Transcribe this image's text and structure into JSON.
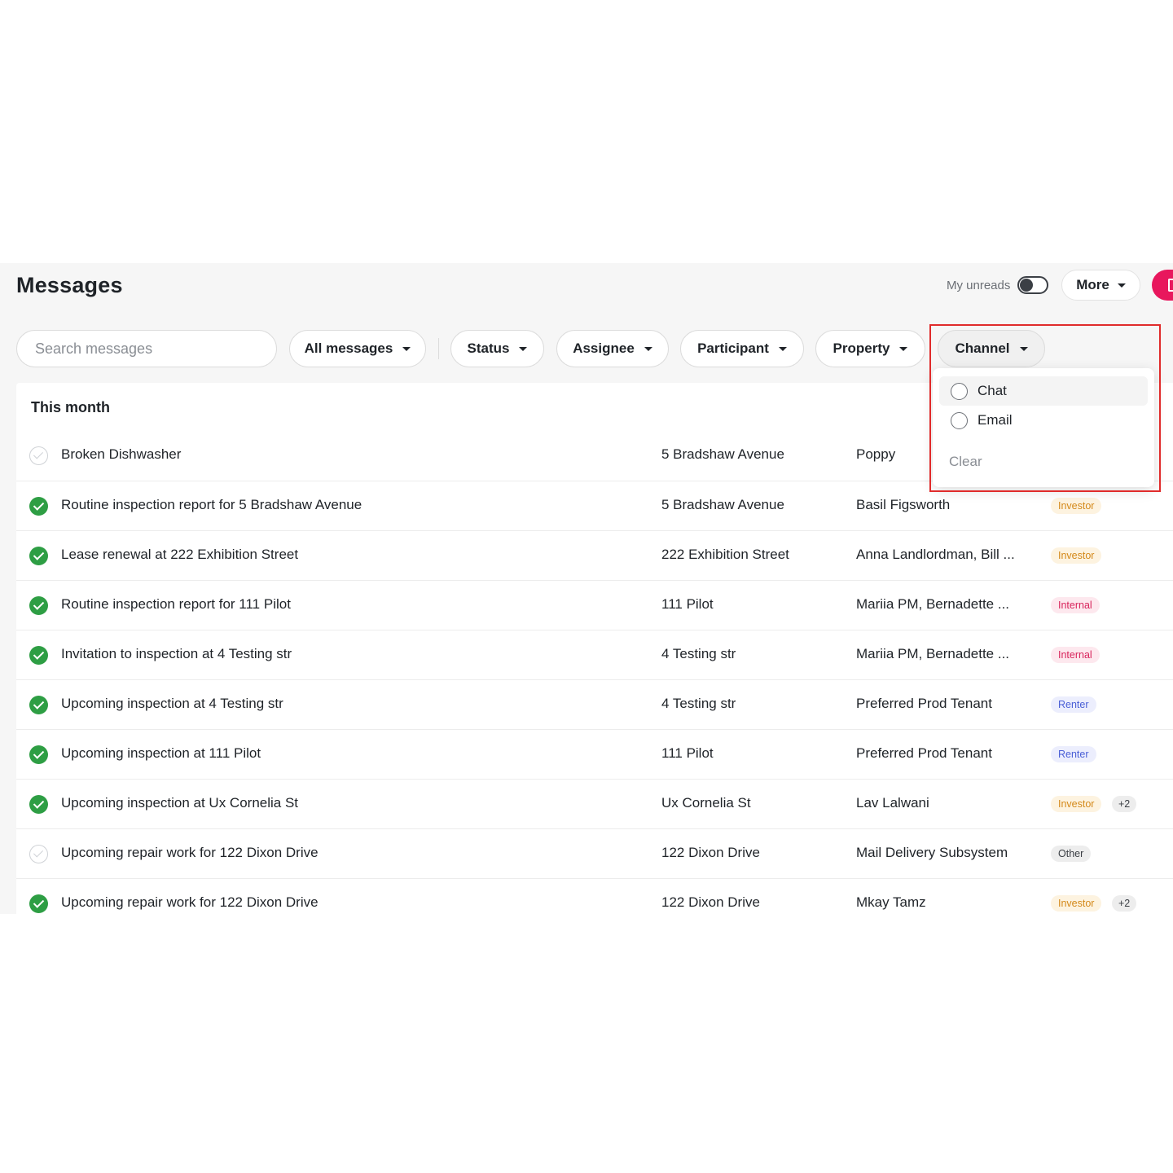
{
  "header": {
    "title": "Messages",
    "unreads_label": "My unreads",
    "more_label": "More"
  },
  "filters": {
    "search_placeholder": "Search messages",
    "all_messages": "All messages",
    "status": "Status",
    "assignee": "Assignee",
    "participant": "Participant",
    "property": "Property",
    "channel": "Channel"
  },
  "section": {
    "title": "This month"
  },
  "rows": [
    {
      "status": "open",
      "subject": "Broken Dishwasher",
      "property": "5 Bradshaw Avenue",
      "people": "Poppy",
      "tag": "",
      "tag_type": "",
      "extra": ""
    },
    {
      "status": "done",
      "subject": "Routine inspection report for 5 Bradshaw Avenue",
      "property": "5 Bradshaw Avenue",
      "people": "Basil Figsworth",
      "tag": "Investor",
      "tag_type": "investor",
      "extra": ""
    },
    {
      "status": "done",
      "subject": "Lease renewal at 222 Exhibition Street",
      "property": "222 Exhibition Street",
      "people": "Anna Landlordman, Bill ...",
      "tag": "Investor",
      "tag_type": "investor",
      "extra": ""
    },
    {
      "status": "done",
      "subject": "Routine inspection report for 111 Pilot",
      "property": "111 Pilot",
      "people": "Mariia PM, Bernadette ...",
      "tag": "Internal",
      "tag_type": "internal",
      "extra": ""
    },
    {
      "status": "done",
      "subject": "Invitation to inspection at 4 Testing str",
      "property": "4 Testing str",
      "people": "Mariia PM, Bernadette ...",
      "tag": "Internal",
      "tag_type": "internal",
      "extra": ""
    },
    {
      "status": "done",
      "subject": "Upcoming inspection at 4 Testing str",
      "property": "4 Testing str",
      "people": "Preferred Prod Tenant",
      "tag": "Renter",
      "tag_type": "renter",
      "extra": ""
    },
    {
      "status": "done",
      "subject": "Upcoming inspection at 111 Pilot",
      "property": "111 Pilot",
      "people": "Preferred Prod Tenant",
      "tag": "Renter",
      "tag_type": "renter",
      "extra": ""
    },
    {
      "status": "done",
      "subject": "Upcoming inspection at Ux Cornelia St",
      "property": "Ux Cornelia St",
      "people": "Lav Lalwani",
      "tag": "Investor",
      "tag_type": "investor",
      "extra": "+2"
    },
    {
      "status": "open",
      "subject": "Upcoming repair work for 122 Dixon Drive",
      "property": "122 Dixon Drive",
      "people": "Mail Delivery Subsystem",
      "tag": "Other",
      "tag_type": "other",
      "extra": ""
    },
    {
      "status": "done",
      "subject": "Upcoming repair work for 122 Dixon Drive",
      "property": "122 Dixon Drive",
      "people": "Mkay Tamz",
      "tag": "Investor",
      "tag_type": "investor",
      "extra": "+2"
    }
  ],
  "channel_dropdown": {
    "options": [
      "Chat",
      "Email"
    ],
    "clear_label": "Clear"
  },
  "colors": {
    "accent": "#e8175d",
    "done": "#2e9e44",
    "highlight": "#e02b2b"
  },
  "icons": {
    "caret": "chevron-down-icon",
    "status_done": "check-circle-icon",
    "status_open": "check-outline-icon",
    "new_message": "compose-icon"
  }
}
